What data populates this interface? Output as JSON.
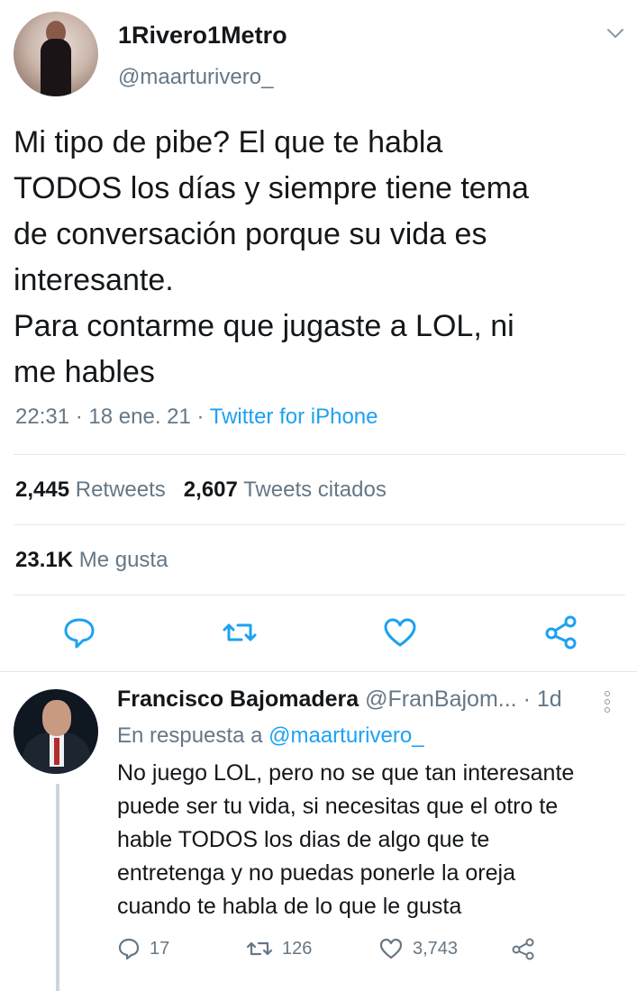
{
  "tweet": {
    "display_name": "1Rivero1Metro",
    "handle": "@maarturivero_",
    "text": "Mi tipo de pibe? El que te habla\nTODOS los días y siempre tiene tema\nde conversación porque su vida es\ninteresante.\nPara contarme que jugaste a LOL, ni\nme hables",
    "time": "22:31",
    "date": "18 ene. 21",
    "source": "Twitter for iPhone",
    "retweets_count": "2,445",
    "retweets_label": "Retweets",
    "quotes_count": "2,607",
    "quotes_label": "Tweets citados",
    "likes_count": "23.1K",
    "likes_label": "Me gusta",
    "actions": [
      "reply-icon",
      "retweet-icon",
      "like-icon",
      "share-icon"
    ]
  },
  "reply": {
    "display_name": "Francisco Bajomadera",
    "handle": "@FranBajom...",
    "age": "· 1d",
    "in_reply_prefix": "En respuesta a",
    "in_reply_mention": "@maarturivero_",
    "text": "No juego LOL, pero no se que tan interesante\npuede ser tu vida, si necesitas que el otro te\nhable TODOS los dias de algo que te\nentretenga y no puedas ponerle la oreja\ncuando te habla de lo que le gusta",
    "replies": "17",
    "retweets": "126",
    "likes": "3,743"
  },
  "colors": {
    "accent": "#1da1f2",
    "muted": "#657786",
    "text": "#14171a",
    "divider": "#e1e8ed"
  }
}
